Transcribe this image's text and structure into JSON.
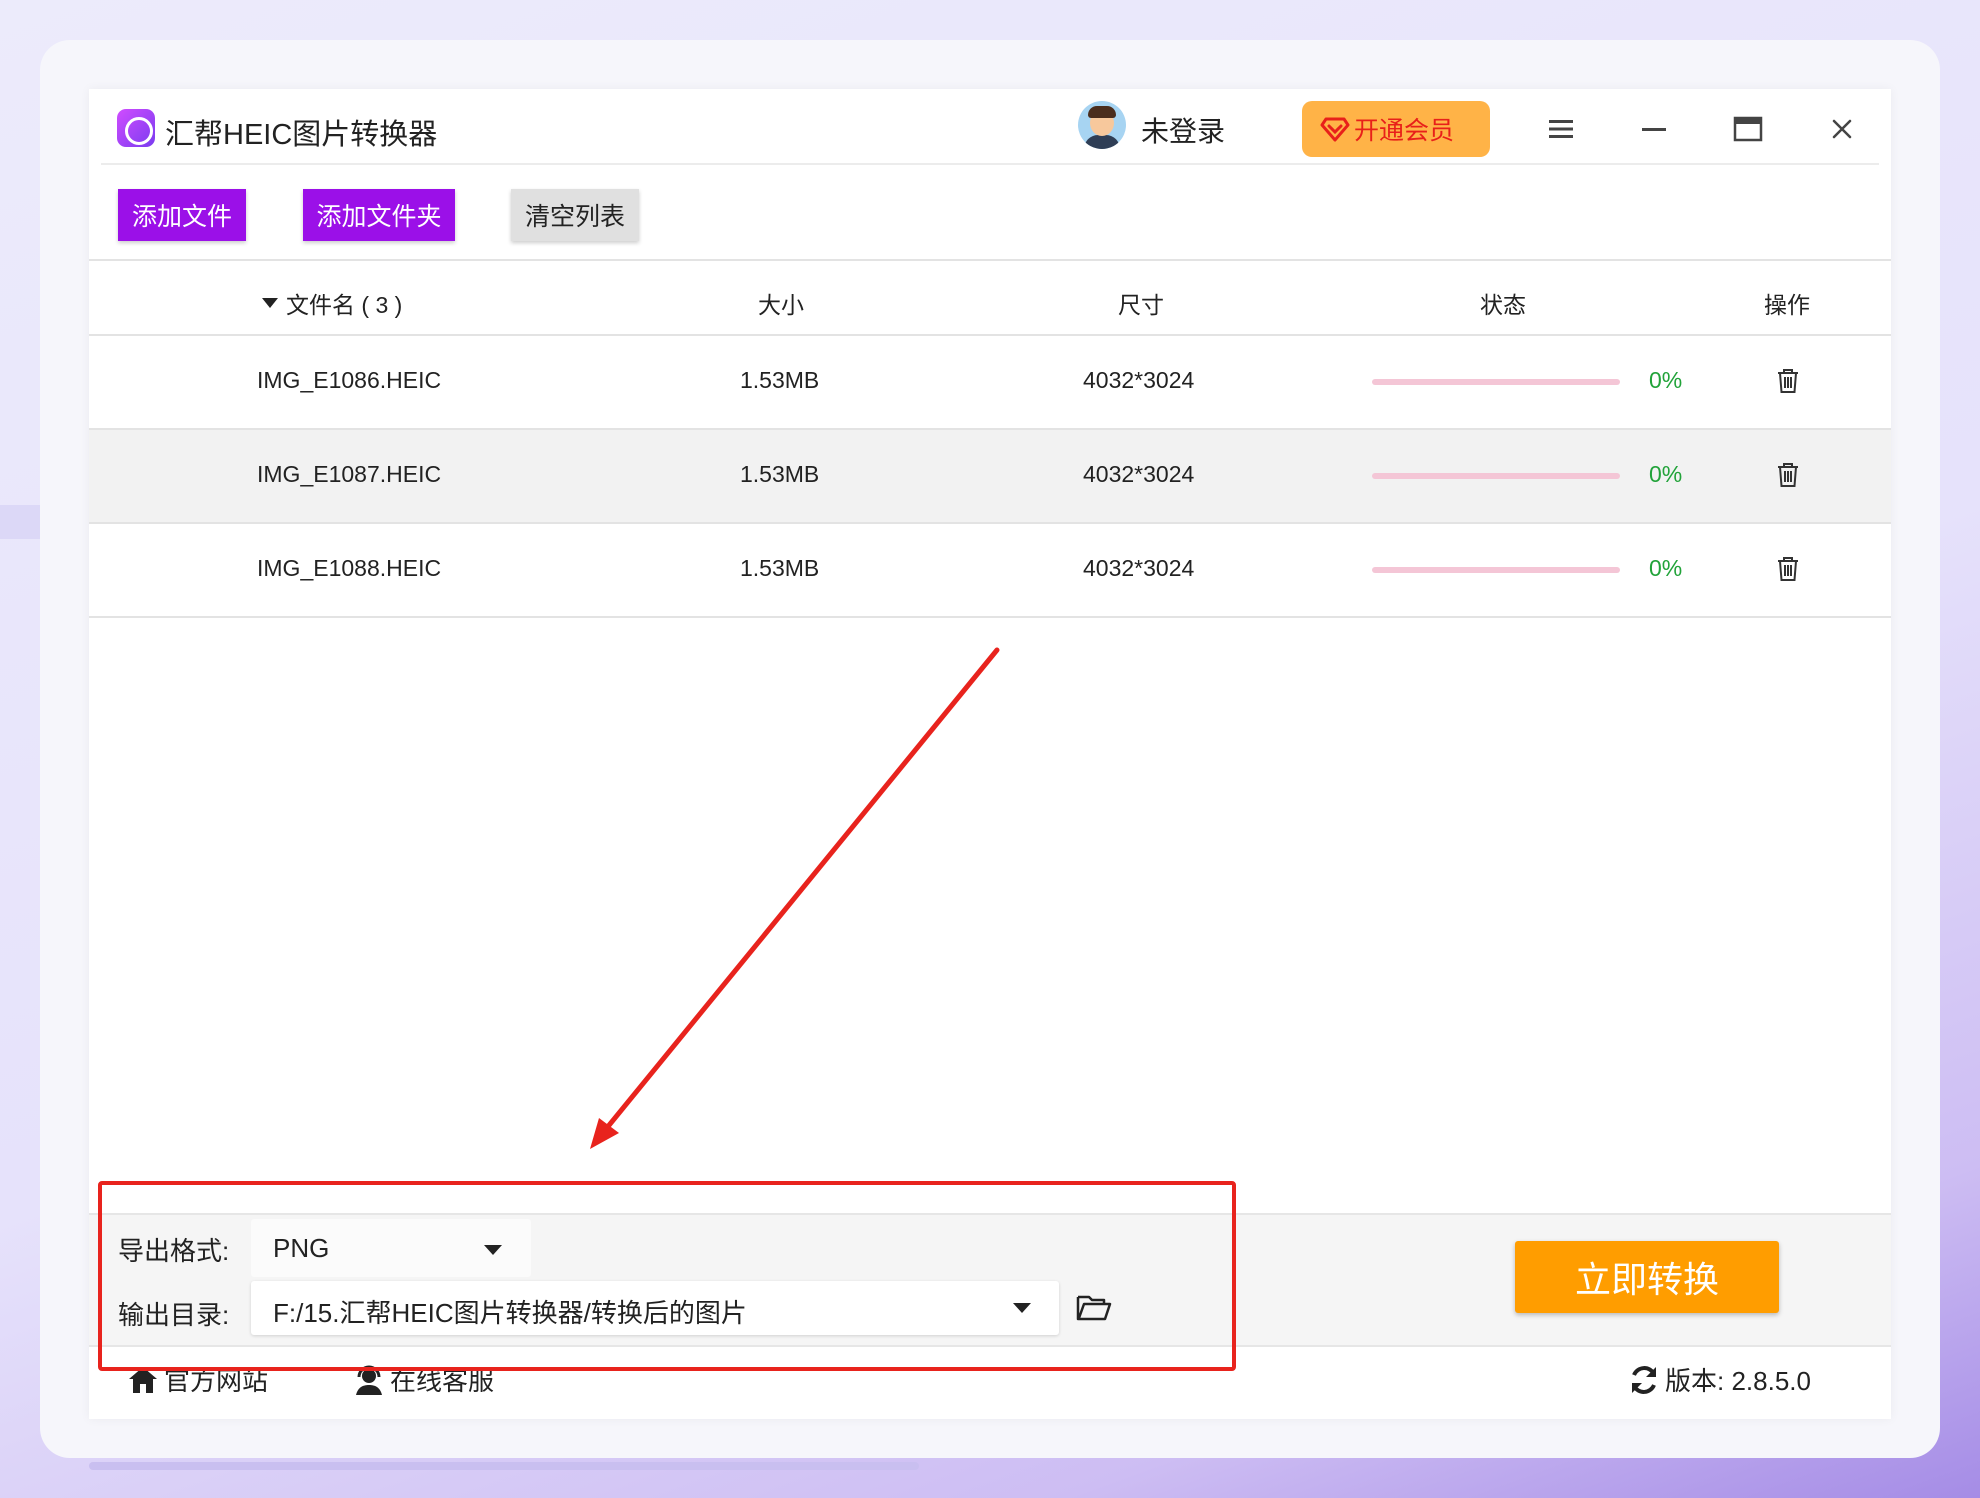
{
  "app": {
    "title": "汇帮HEIC图片转换器",
    "login_status": "未登录",
    "vip_label": "开通会员"
  },
  "window_controls": {
    "menu": "menu-icon",
    "minimize": "minimize-icon",
    "maximize": "maximize-icon",
    "close": "close-icon"
  },
  "toolbar": {
    "add_file": "添加文件",
    "add_folder": "添加文件夹",
    "clear_list": "清空列表"
  },
  "table": {
    "headers": {
      "filename": "文件名 ( 3 )",
      "size": "大小",
      "dimensions": "尺寸",
      "status": "状态",
      "action": "操作"
    },
    "rows": [
      {
        "filename": "IMG_E1086.HEIC",
        "size": "1.53MB",
        "dimensions": "4032*3024",
        "progress": "0%"
      },
      {
        "filename": "IMG_E1087.HEIC",
        "size": "1.53MB",
        "dimensions": "4032*3024",
        "progress": "0%"
      },
      {
        "filename": "IMG_E1088.HEIC",
        "size": "1.53MB",
        "dimensions": "4032*3024",
        "progress": "0%"
      }
    ]
  },
  "settings": {
    "format_label": "导出格式:",
    "format_value": "PNG",
    "output_label": "输出目录:",
    "output_value": "F:/15.汇帮HEIC图片转换器/转换后的图片"
  },
  "convert_button": "立即转换",
  "footer": {
    "website": "官方网站",
    "support": "在线客服",
    "version": "版本:  2.8.5.0"
  },
  "colors": {
    "accent_purple": "#9b10e8",
    "convert_orange": "#ff9d00",
    "vip_orange": "#ffb347",
    "progress_track": "#f4c6d6",
    "progress_text": "#22a33a",
    "annotation_red": "#e8231d"
  }
}
